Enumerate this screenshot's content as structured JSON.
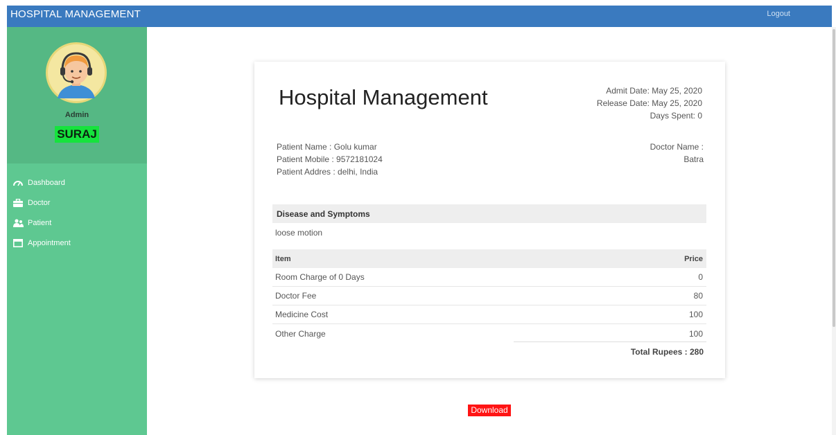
{
  "header": {
    "brand": "HOSPITAL MANAGEMENT",
    "logout_label": "Logout"
  },
  "sidebar": {
    "role": "Admin",
    "username": "SURAJ",
    "items": [
      {
        "label": "Dashboard",
        "icon": "tachometer-icon"
      },
      {
        "label": "Doctor",
        "icon": "briefcase-icon"
      },
      {
        "label": "Patient",
        "icon": "users-icon"
      },
      {
        "label": "Appointment",
        "icon": "calendar-icon"
      }
    ]
  },
  "invoice": {
    "title": "Hospital Management",
    "admit_date": "Admit Date: May 25, 2020",
    "release_date": "Release Date: May 25, 2020",
    "days_spent": "Days Spent: 0",
    "patient_name": "Patient Name : Golu kumar",
    "patient_mobile": "Patient Mobile : 9572181024",
    "patient_address": "Patient Addres : delhi, India",
    "doctor_label": "Doctor Name :",
    "doctor_name": "Batra",
    "disease_header": "Disease and Symptoms",
    "symptoms": "loose motion",
    "table": {
      "headers": {
        "item": "Item",
        "price": "Price"
      },
      "rows": [
        {
          "item": "Room Charge of 0 Days",
          "price": "0"
        },
        {
          "item": "Doctor Fee",
          "price": "80"
        },
        {
          "item": "Medicine Cost",
          "price": "100"
        },
        {
          "item": "Other Charge",
          "price": "100"
        }
      ]
    },
    "total": "Total Rupees : 280"
  },
  "download_label": "Download",
  "colors": {
    "topbar": "#3a7abf",
    "sidebar": "#5ec891",
    "profile_panel": "#55b884",
    "username_badge": "#16e33d",
    "download_button": "#ff1414"
  }
}
